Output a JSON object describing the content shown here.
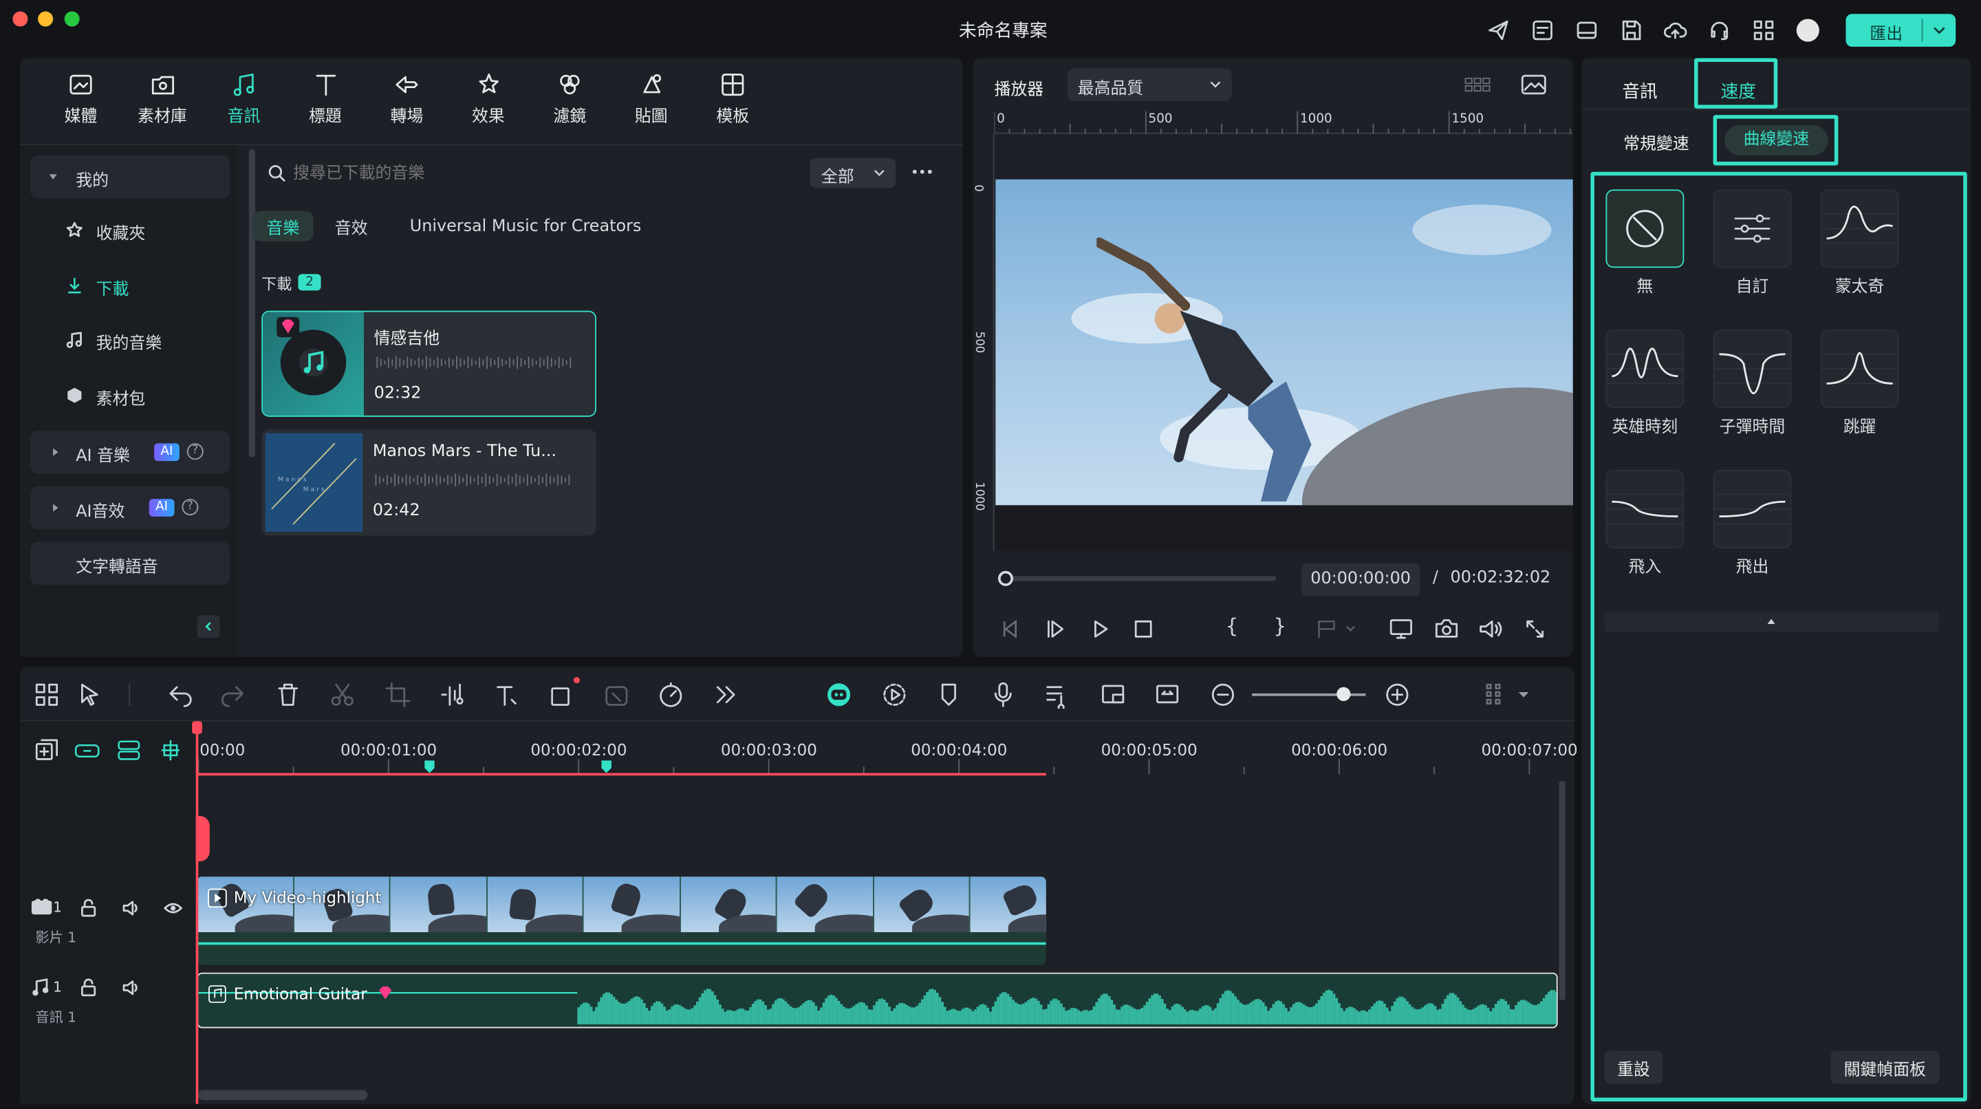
{
  "window": {
    "title": "未命名專案",
    "export_label": "匯出"
  },
  "media_tabs": [
    {
      "label": "媒體",
      "icon": "media-icon"
    },
    {
      "label": "素材庫",
      "icon": "stock-icon"
    },
    {
      "label": "音訊",
      "icon": "music-note-icon",
      "active": true
    },
    {
      "label": "標題",
      "icon": "title-icon"
    },
    {
      "label": "轉場",
      "icon": "transition-icon"
    },
    {
      "label": "效果",
      "icon": "effects-icon"
    },
    {
      "label": "濾鏡",
      "icon": "filters-icon"
    },
    {
      "label": "貼圖",
      "icon": "sticker-icon"
    },
    {
      "label": "模板",
      "icon": "template-icon"
    }
  ],
  "sidebar": {
    "my": "我的",
    "favorites": "收藏夾",
    "downloads": "下載",
    "my_music": "我的音樂",
    "packs": "素材包",
    "ai_music": "AI 音樂",
    "ai_sfx": "AI音效",
    "ai_badge": "AI",
    "tts": "文字轉語音"
  },
  "library": {
    "search_placeholder": "搜尋已下載的音樂",
    "filter": "全部",
    "subtabs": [
      "音樂",
      "音效",
      "Universal Music for Creators"
    ],
    "section": "下載",
    "count": "2",
    "cards": [
      {
        "title": "情感吉他",
        "duration": "02:32"
      },
      {
        "title": "Manos Mars - The Tu...",
        "duration": "02:42"
      }
    ]
  },
  "player": {
    "label": "播放器",
    "quality": "最高品質",
    "ruler": [
      "0",
      "500",
      "1000",
      "1500"
    ],
    "vruler": [
      "0",
      "500",
      "1000"
    ],
    "current": "00:00:00:00",
    "separator": "/",
    "total": "00:02:32:02"
  },
  "right_panel": {
    "tab_audio": "音訊",
    "tab_speed": "速度",
    "sub_normal": "常規變速",
    "sub_curve": "曲線變速",
    "presets": [
      "無",
      "自訂",
      "蒙太奇",
      "英雄時刻",
      "子彈時間",
      "跳躍",
      "飛入",
      "飛出"
    ],
    "reset": "重設",
    "keyframe": "關鍵幀面板"
  },
  "timeline": {
    "ticks": [
      "00:00",
      "00:00:01:00",
      "00:00:02:00",
      "00:00:03:00",
      "00:00:04:00",
      "00:00:05:00",
      "00:00:06:00",
      "00:00:07:00"
    ],
    "video_track": {
      "num": "1",
      "name": "影片 1",
      "clip": "My Video-highlight"
    },
    "audio_track": {
      "num": "1",
      "name": "音訊 1",
      "clip": "Emotional Guitar"
    }
  },
  "colors": {
    "accent": "#35e0c6",
    "playhead": "#ff4b5c",
    "panel": "#1d2026",
    "bg": "#121418"
  }
}
